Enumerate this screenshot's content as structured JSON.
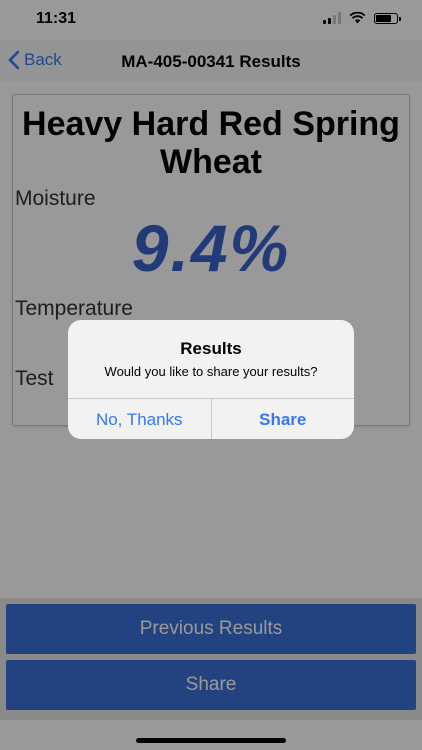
{
  "status": {
    "time": "11:31"
  },
  "nav": {
    "back_label": "Back",
    "title": "MA-405-00341 Results"
  },
  "result": {
    "product": "Heavy Hard Red Spring Wheat",
    "moisture_label": "Moisture",
    "moisture_value": "9.4%",
    "temperature_label": "Temperature",
    "test_label": "Test"
  },
  "buttons": {
    "previous_results": "Previous Results",
    "share": "Share"
  },
  "dialog": {
    "title": "Results",
    "message": "Would you like to share your results?",
    "cancel": "No, Thanks",
    "confirm": "Share"
  },
  "colors": {
    "accent": "#3478f6",
    "moisture": "#3a63c8",
    "button": "#3a6fd6"
  }
}
